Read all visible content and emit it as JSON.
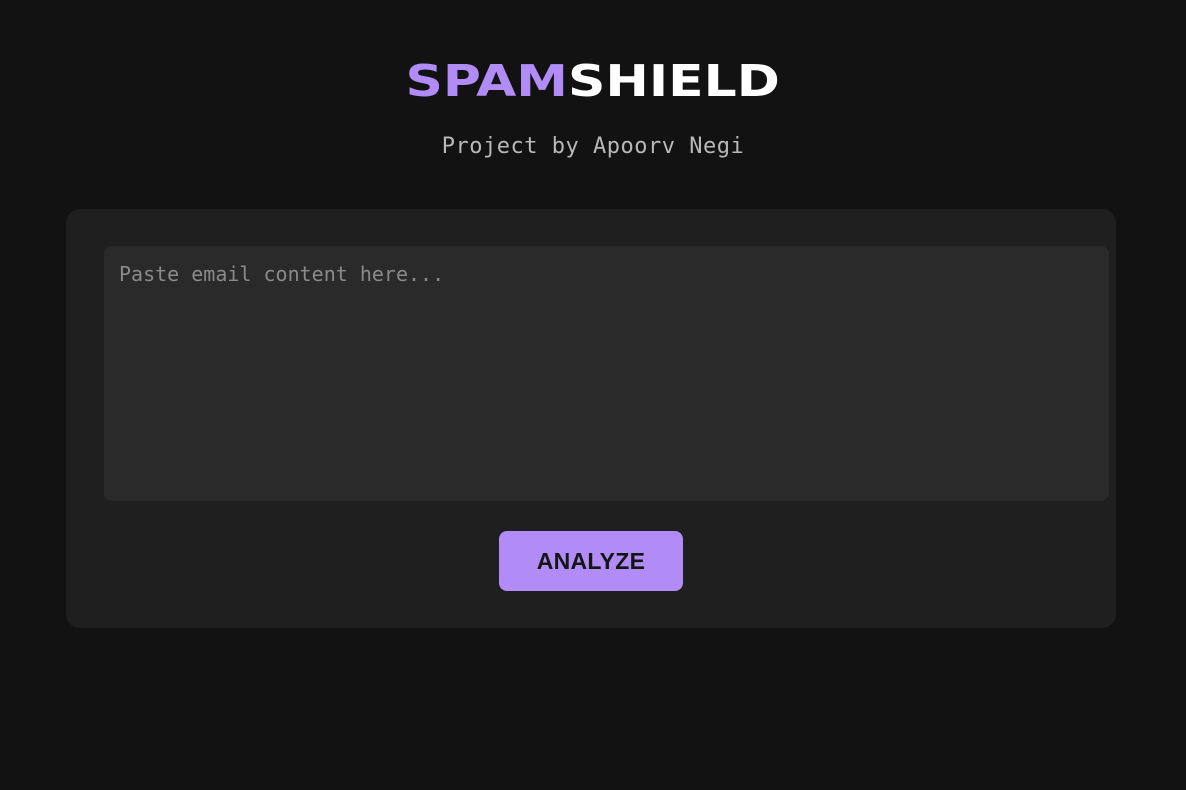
{
  "header": {
    "logo_accent": "SPAM",
    "logo_main": "SHIELD",
    "subtitle": "Project by Apoorv Negi"
  },
  "form": {
    "email_placeholder": "Paste email content here...",
    "email_value": "",
    "analyze_label": "ANALYZE"
  },
  "colors": {
    "background": "#121212",
    "card": "#1f1f1f",
    "input": "#2a2a2a",
    "accent": "#b18cf7"
  }
}
